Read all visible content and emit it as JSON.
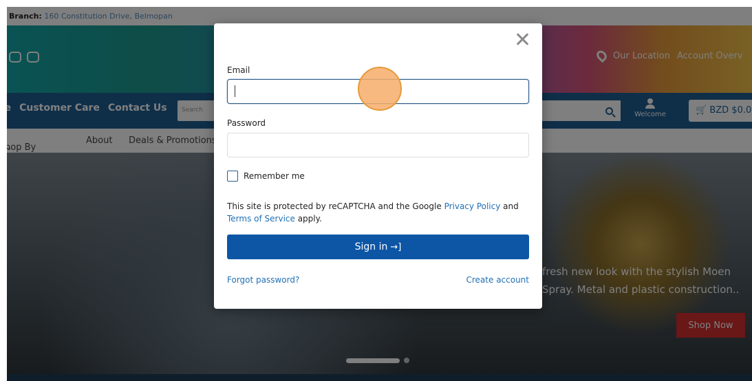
{
  "site": {
    "branch_label": "Branch:",
    "branch_address": "160 Constitution Drive, Belmopan",
    "header_links": [
      "Our Location",
      "Account Overv"
    ],
    "nav": {
      "links": [
        "me",
        "Customer Care",
        "Contact Us"
      ],
      "search_placeholder": "Search",
      "welcome": "Welcome",
      "cart": "BZD $0.0"
    },
    "subnav": [
      "hop By",
      "About",
      "Deals & Promotions"
    ],
    "hero": {
      "line1": "fresh new look with the stylish Moen",
      "line2": "Spray. Metal and plastic construction..",
      "cta": "Shop Now"
    }
  },
  "modal": {
    "email_label": "Email",
    "email_value": "",
    "password_label": "Password",
    "password_value": "",
    "remember_label": "Remember me",
    "recaptcha_prefix": "This site is protected by reCAPTCHA and the Google ",
    "privacy_link": "Privacy Policy",
    "and_text": " and ",
    "terms_link": "Terms of Service",
    "recaptcha_suffix": " apply.",
    "signin_label": "Sign in",
    "signin_icon": "→]",
    "forgot_link": "Forgot password?",
    "create_link": "Create account"
  },
  "colors": {
    "primary": "#0d56a6",
    "link": "#1f6fb5",
    "nav": "#1e5f93",
    "cta_red": "#d32f2f"
  }
}
